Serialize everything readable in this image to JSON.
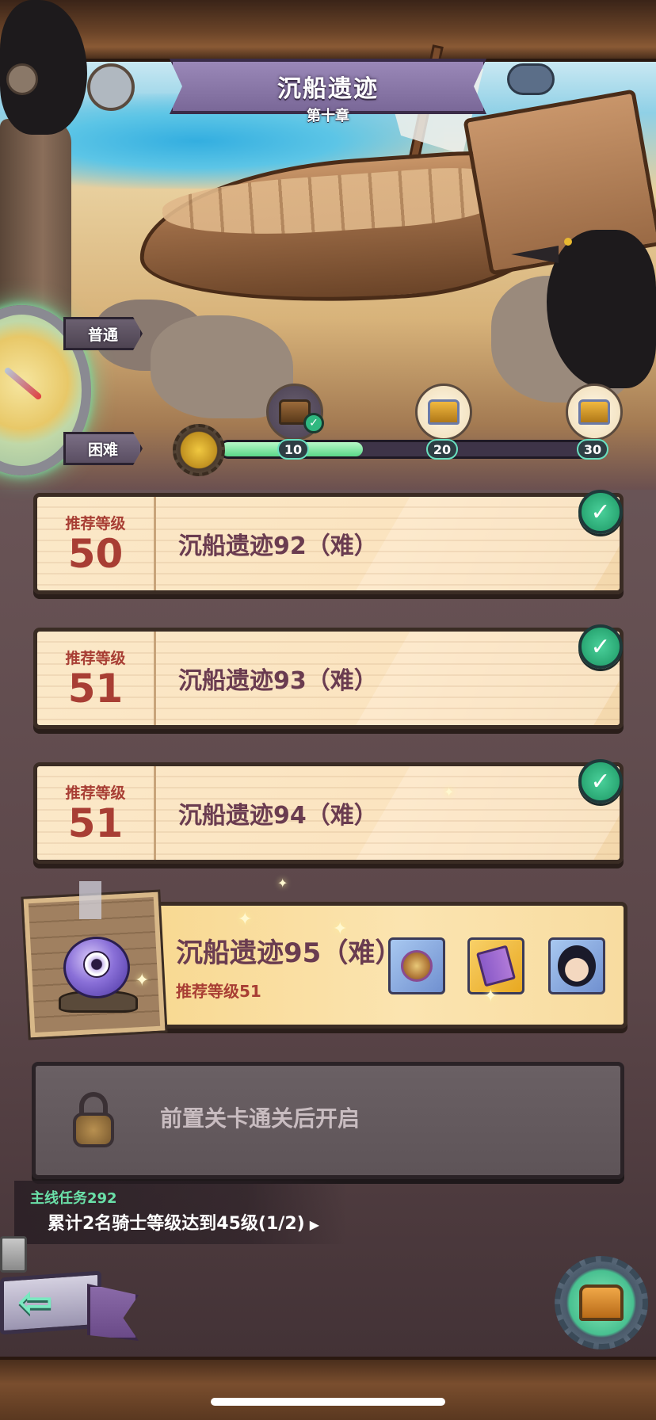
{
  "header": {
    "title": "沉船遗迹",
    "chapter": "第十章"
  },
  "difficulty": {
    "normal_label": "普通",
    "hard_label": "困难",
    "selected": "困难"
  },
  "progress": {
    "current": 11,
    "max": 30,
    "fraction": 0.37,
    "milestones": [
      {
        "value": "10",
        "claimed": true,
        "icon": "chest-icon"
      },
      {
        "value": "20",
        "claimed": false,
        "icon": "chest-icon"
      },
      {
        "value": "30",
        "claimed": false,
        "icon": "chest-icon"
      }
    ]
  },
  "stages": [
    {
      "level_label": "推荐等级",
      "level": "50",
      "name": "沉船遗迹92（难）",
      "cleared": true
    },
    {
      "level_label": "推荐等级",
      "level": "51",
      "name": "沉船遗迹93（难）",
      "cleared": true
    },
    {
      "level_label": "推荐等级",
      "level": "51",
      "name": "沉船遗迹94（难）",
      "cleared": true
    }
  ],
  "current_stage": {
    "name": "沉船遗迹95（难）",
    "level_text": "推荐等级51",
    "rewards": [
      "medal-icon",
      "book-icon",
      "hero-portrait-icon"
    ]
  },
  "locked_stage": {
    "text": "前置关卡通关后开启"
  },
  "mission": {
    "title": "主线任务292",
    "text": "累计2名骑士等级达到45级(1/2)",
    "arrow": "▶"
  },
  "buttons": {
    "back_arrow": "⇦"
  },
  "colors": {
    "accent_green": "#2fb880",
    "level_red": "#a83e34",
    "stage_name_purple": "#6a3c50",
    "mission_green": "#6ae0a8"
  }
}
